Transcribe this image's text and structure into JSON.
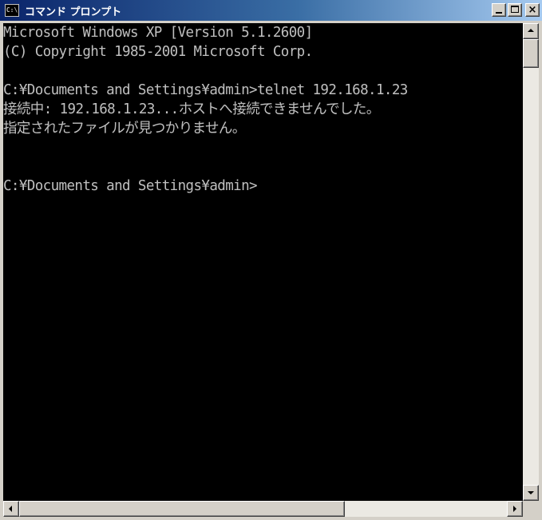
{
  "window": {
    "title": "コマンド プロンプト",
    "icon": "cmd-icon",
    "icon_text": "C:\\"
  },
  "console": {
    "lines": [
      "Microsoft Windows XP [Version 5.1.2600]",
      "(C) Copyright 1985-2001 Microsoft Corp.",
      "",
      "C:¥Documents and Settings¥admin>telnet 192.168.1.23",
      "接続中: 192.168.1.23...ホストへ接続できませんでした。",
      "指定されたファイルが見つかりません。",
      "",
      "",
      "C:¥Documents and Settings¥admin>"
    ]
  },
  "scrollbars": {
    "vertical_position": 0.0,
    "horizontal_position": 0.0
  },
  "colors": {
    "console_background": "#000000",
    "console_text": "#c0c0c0",
    "titlebar_start": "#0a246a",
    "titlebar_end": "#a6caf0"
  }
}
